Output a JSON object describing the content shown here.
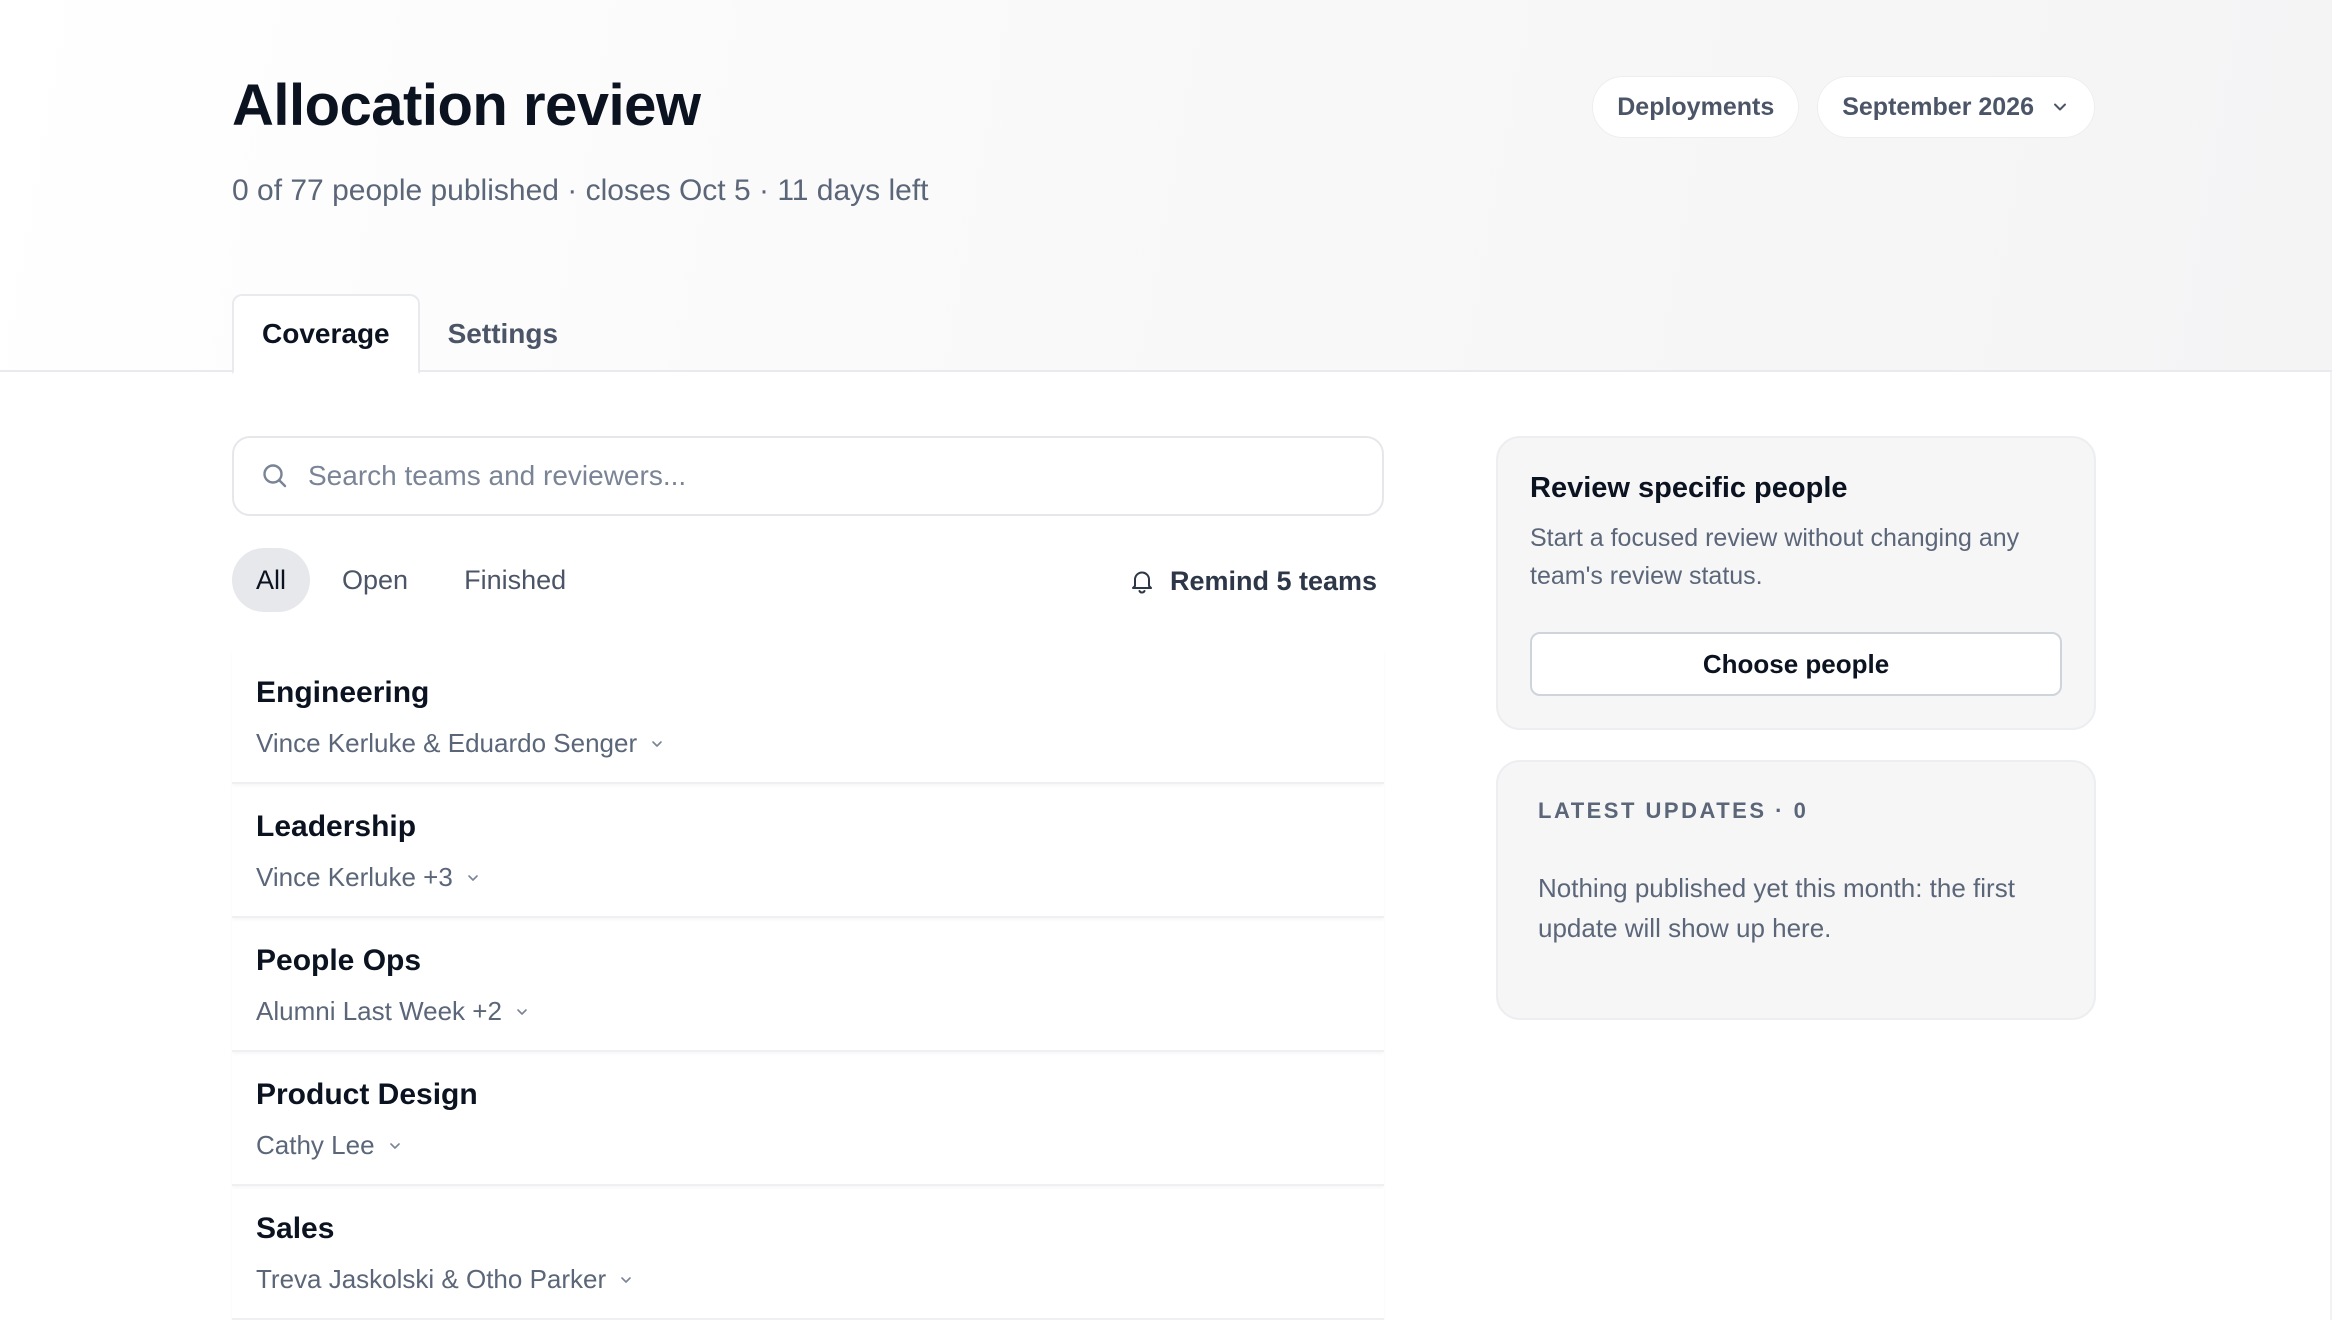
{
  "header": {
    "title": "Allocation review",
    "subtitle": "0 of 77 people published · closes Oct 5 · 11 days left",
    "deployments_label": "Deployments",
    "period_label": "September 2026"
  },
  "tabs": [
    {
      "label": "Coverage",
      "active": true
    },
    {
      "label": "Settings",
      "active": false
    }
  ],
  "search": {
    "placeholder": "Search teams and reviewers...",
    "value": ""
  },
  "filters": [
    {
      "label": "All",
      "active": true
    },
    {
      "label": "Open",
      "active": false
    },
    {
      "label": "Finished",
      "active": false
    }
  ],
  "remind": {
    "label": "Remind 5 teams"
  },
  "teams": [
    {
      "name": "Engineering",
      "reviewers": "Vince Kerluke & Eduardo Senger"
    },
    {
      "name": "Leadership",
      "reviewers": "Vince Kerluke +3"
    },
    {
      "name": "People Ops",
      "reviewers": "Alumni Last Week +2"
    },
    {
      "name": "Product Design",
      "reviewers": "Cathy Lee"
    },
    {
      "name": "Sales",
      "reviewers": "Treva Jaskolski & Otho Parker"
    }
  ],
  "review_card": {
    "title": "Review specific people",
    "description": "Start a focused review without changing any team's review status.",
    "button_label": "Choose people"
  },
  "updates_card": {
    "label": "LATEST UPDATES · 0",
    "empty_text": "Nothing published yet this month: the first update will show up here."
  },
  "icons": {
    "search": "search-icon",
    "bell": "bell-icon",
    "chevron": "chevron-down-icon"
  },
  "colors": {
    "text_primary": "#0b1220",
    "text_secondary": "#5b6679",
    "active_filter_bg": "#e7e8eb",
    "card_bg": "#f6f6f7"
  }
}
